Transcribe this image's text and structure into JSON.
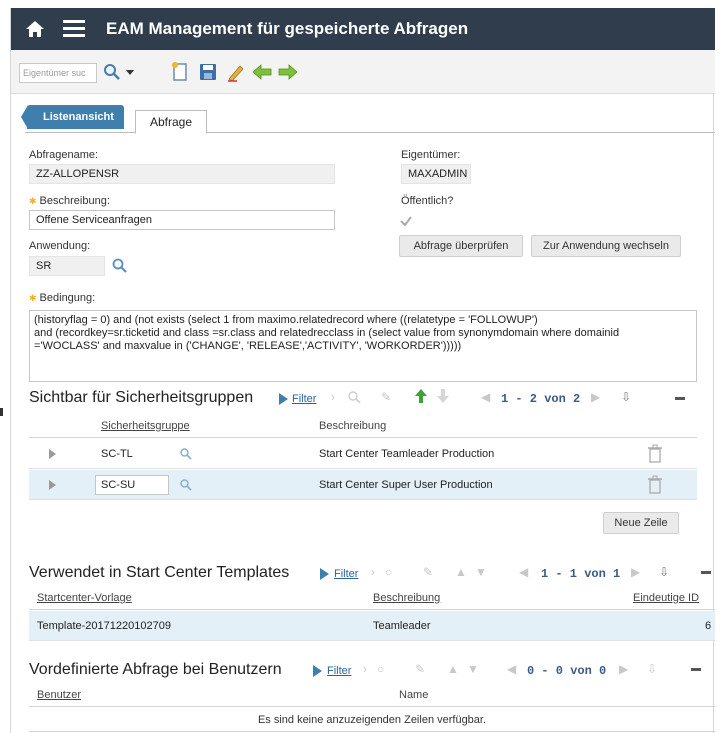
{
  "header": {
    "title": "EAM Management für gespeicherte Abfragen"
  },
  "toolbar": {
    "search_placeholder": "Eigentümer suc"
  },
  "tabs": {
    "list": "Listenansicht",
    "query": "Abfrage"
  },
  "form": {
    "query_name_label": "Abfragename:",
    "query_name_value": "ZZ-ALLOPENSR",
    "owner_label": "Eigentümer:",
    "owner_value": "MAXADMIN",
    "description_label": "Beschreibung:",
    "description_value": "Offene Serviceanfragen",
    "public_label": "Öffentlich?",
    "public_checked": true,
    "application_label": "Anwendung:",
    "application_value": "SR",
    "check_query_button": "Abfrage überprüfen",
    "goto_app_button": "Zur Anwendung wechseln",
    "condition_label": "Bedingung:",
    "condition_lines": [
      "(historyflag = 0) and (not exists (select 1 from maximo.relatedrecord where ((relatetype = 'FOLLOWUP')",
      "and (recordkey=sr.ticketid and class =sr.class and relatedrecclass in (select value from synonymdomain where domainid",
      "='WOCLASS' and maxvalue in ('CHANGE', 'RELEASE','ACTIVITY', 'WORKORDER')))))"
    ]
  },
  "security_groups": {
    "title": "Sichtbar für Sicherheitsgruppen",
    "filter": "Filter",
    "pager": "1 - 2 von 2",
    "col_group": "Sicherheitsgruppe",
    "col_desc": "Beschreibung",
    "rows": [
      {
        "group": "SC-TL",
        "description": "Start Center Teamleader Production"
      },
      {
        "group": "SC-SU",
        "description": "Start Center Super User Production"
      }
    ],
    "new_row_button": "Neue Zeile"
  },
  "templates": {
    "title": "Verwendet in Start Center Templates",
    "filter": "Filter",
    "pager": "1 - 1 von 1",
    "col_template": "Startcenter-Vorlage",
    "col_desc": "Beschreibung",
    "col_id": "Eindeutige ID",
    "rows": [
      {
        "template": "Template-20171220102709",
        "description": "Teamleader",
        "id": "6"
      }
    ]
  },
  "users": {
    "title": "Vordefinierte Abfrage bei Benutzern",
    "filter": "Filter",
    "pager": "0 - 0 von 0",
    "col_user": "Benutzer",
    "col_name": "Name",
    "empty_text": "Es sind keine anzuzeigenden Zeilen verfügbar."
  },
  "colors": {
    "title_bar": "#2f3d4c",
    "tab_active": "#3f7fae",
    "selected_row": "#e4f0f7",
    "required_star": "#f0b020"
  }
}
